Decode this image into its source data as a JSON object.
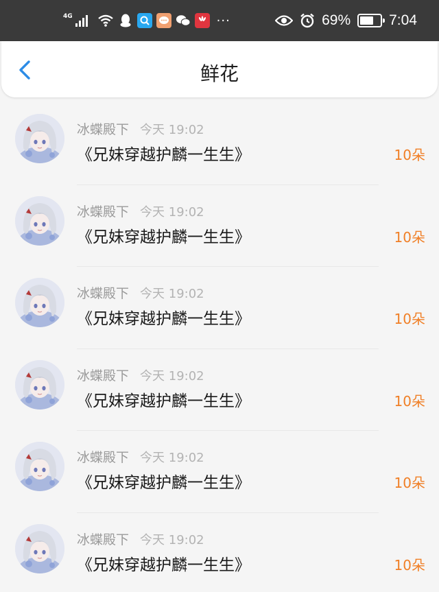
{
  "status_bar": {
    "network": "4G",
    "battery": "69%",
    "battery_level": 0.69,
    "time": "7:04",
    "app_icons": [
      "qq-icon",
      "search-icon",
      "chat-icon",
      "wechat-icon",
      "huawei-icon"
    ]
  },
  "header": {
    "title": "鲜花"
  },
  "items": [
    {
      "user": "冰蝶殿下",
      "time": "今天 19:02",
      "book": "《兄妹穿越护麟一生生》",
      "amount": "10朵"
    },
    {
      "user": "冰蝶殿下",
      "time": "今天 19:02",
      "book": "《兄妹穿越护麟一生生》",
      "amount": "10朵"
    },
    {
      "user": "冰蝶殿下",
      "time": "今天 19:02",
      "book": "《兄妹穿越护麟一生生》",
      "amount": "10朵"
    },
    {
      "user": "冰蝶殿下",
      "time": "今天 19:02",
      "book": "《兄妹穿越护麟一生生》",
      "amount": "10朵"
    },
    {
      "user": "冰蝶殿下",
      "time": "今天 19:02",
      "book": "《兄妹穿越护麟一生生》",
      "amount": "10朵"
    },
    {
      "user": "冰蝶殿下",
      "time": "今天 19:02",
      "book": "《兄妹穿越护麟一生生》",
      "amount": "10朵"
    }
  ],
  "colors": {
    "accent": "#2d8ce6",
    "amount": "#f07f26",
    "status_bar": "#3a3a3a"
  }
}
